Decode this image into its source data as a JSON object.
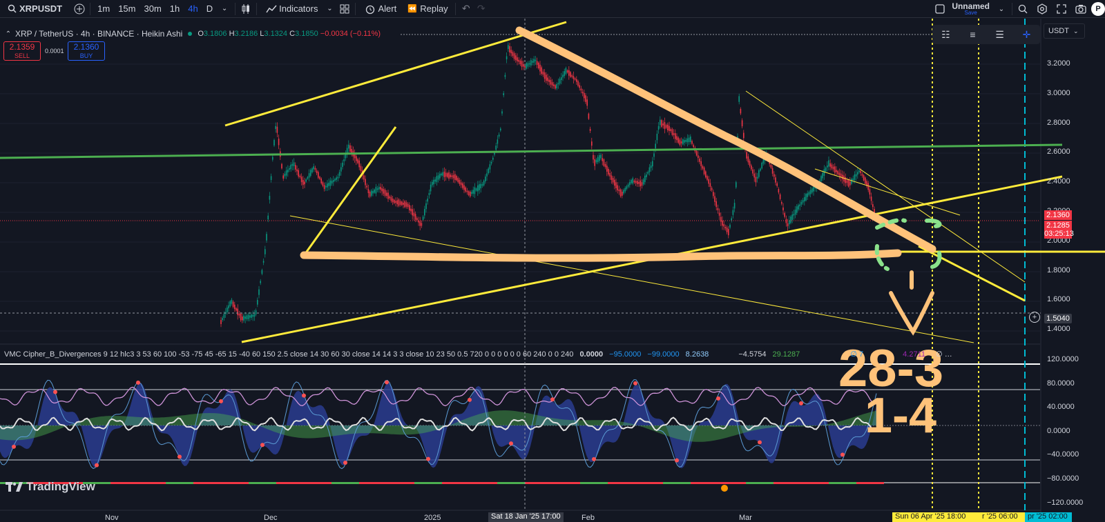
{
  "toolbar": {
    "symbol": "XRPUSDT",
    "timeframes": [
      "1m",
      "15m",
      "30m",
      "1h",
      "4h",
      "D"
    ],
    "active_timeframe": "4h",
    "indicators_label": "Indicators",
    "alert_label": "Alert",
    "replay_label": "Replay",
    "layout_name": "Unnamed",
    "layout_save": "Save",
    "avatar_letter": "P"
  },
  "legend": {
    "title": "XRP / TetherUS · 4h · BINANCE · Heikin Ashi",
    "o_label": "O",
    "o": "3.1806",
    "h_label": "H",
    "h": "3.2186",
    "l_label": "L",
    "l": "3.1324",
    "c_label": "C",
    "c": "3.1850",
    "change": "−0.0034 (−0.11%)"
  },
  "trade": {
    "sell_price": "2.1359",
    "sell_label": "SELL",
    "buy_price": "2.1360",
    "buy_label": "BUY",
    "spread": "0.0001"
  },
  "currency": "USDT",
  "price_scale": {
    "ticks": [
      "3.2000",
      "3.0000",
      "2.8000",
      "2.6000",
      "2.4000",
      "2.2000",
      "2.0000",
      "1.8000",
      "1.6000",
      "1.4000"
    ],
    "current_price": "2.1360",
    "secondary_price": "2.1285",
    "countdown": "03:25:13",
    "crosshair_price": "1.5040"
  },
  "oscillator": {
    "name": "VMC Cipher_B_Divergences 9 12 hlc3 3 53 60 100 -53 -75 45 -65 15 -40 60 150 2.5 close 14 30 60 30 close 14 14 3 3 close 10 23 50 0.5 720 0 0 0 0 0 0 60 240 0 0 240",
    "values": [
      "0.0000",
      "−95.0000",
      "−99.0000",
      "8.2638",
      "−4.5754",
      "29.1287"
    ],
    "value_tail": "∅ 7",
    "value_tail2": "4.2711",
    "value_tail3": "∅ …",
    "ticks": [
      "120.0000",
      "80.0000",
      "40.0000",
      "0.0000",
      "−40.0000",
      "−80.0000",
      "−120.0000"
    ]
  },
  "time_axis": {
    "labels": [
      "Nov",
      "Dec",
      "2025",
      "Feb",
      "Mar"
    ],
    "crosshair_time": "Sat 18 Jan '25   17:00",
    "highlight_1": "Sun 06 Apr '25   18:00",
    "highlight_2": "r '25   06:00",
    "highlight_3": "pr '25   02:00"
  },
  "annotation": {
    "line1": "28-3",
    "line2": "1-4"
  },
  "branding": "TradingView",
  "colors": {
    "background": "#131722",
    "bull": "#089981",
    "bear": "#f23645",
    "accent": "#2962ff",
    "trendline_yellow": "#ffeb3b",
    "annotation_orange": "#ffc27a",
    "green_line": "#4caf50"
  }
}
